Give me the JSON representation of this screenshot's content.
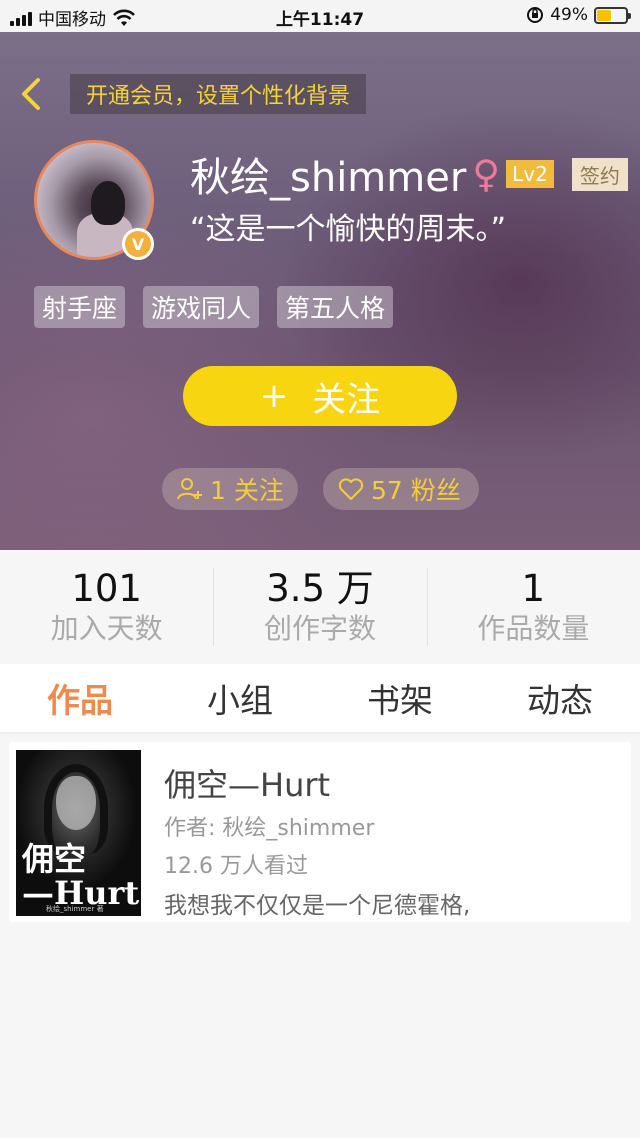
{
  "status_bar": {
    "carrier": "中国移动",
    "time": "上午11:47",
    "battery_percent": "49%",
    "battery_level": 0.49
  },
  "header": {
    "vip_banner": "开通会员，设置个性化背景",
    "username": "秋绘_shimmer",
    "gender_symbol": "♀",
    "level": "Lv2",
    "signed_badge": "签约",
    "motto": "“这是一个愉快的周末。”",
    "avatar_badge": "V",
    "tags": [
      "射手座",
      "游戏同人",
      "第五人格"
    ],
    "follow_button_icon": "+",
    "follow_button_label": "关注",
    "following_count": "1 关注",
    "fans_count": "57 粉丝"
  },
  "stats": [
    {
      "value": "101",
      "label": "加入天数"
    },
    {
      "value": "3.5 万",
      "label": "创作字数"
    },
    {
      "value": "1",
      "label": "作品数量"
    }
  ],
  "tabs": [
    "作品",
    "小组",
    "书架",
    "动态"
  ],
  "work": {
    "title": "佣空—Hurt",
    "author": "作者: 秋绘_shimmer",
    "views": "12.6 万人看过",
    "description": "我想我不仅仅是一个尼德霍格,",
    "cover_title_line1": "佣空",
    "cover_title_line2": "—Hurt",
    "cover_author": "秋绘_shimmer 著"
  },
  "colors": {
    "accent": "#ef8a4a",
    "follow_button": "#f7d511",
    "vip_text": "#f5d23a",
    "gender": "#f07a96"
  }
}
